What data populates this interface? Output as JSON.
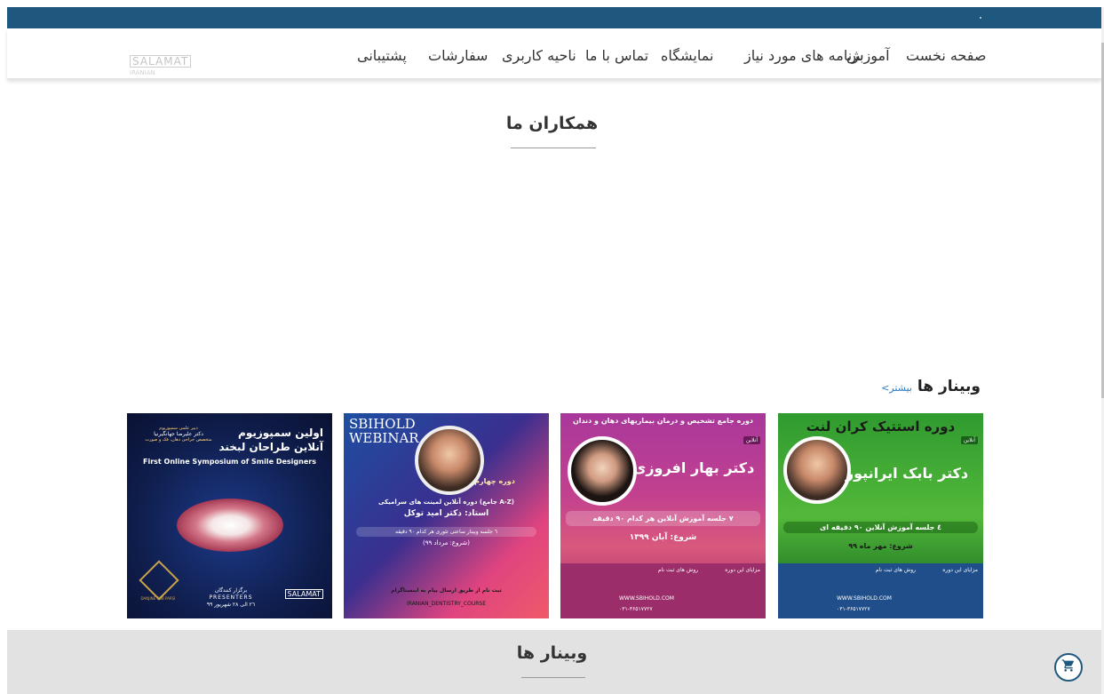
{
  "nav": {
    "items": [
      {
        "label": "صفحه نخست"
      },
      {
        "label": "آموزش"
      },
      {
        "label": "برنامه های مورد نیاز"
      },
      {
        "label": "نمایشگاه"
      },
      {
        "label": "تماس با ما"
      },
      {
        "label": "ناحیه کاربری"
      },
      {
        "label": "سفارشات"
      },
      {
        "label": "پشتیبانی"
      }
    ],
    "logo_text": "SALAMAT",
    "logo_sub": "IRANIAN"
  },
  "partners": {
    "title": "همکاران ما"
  },
  "webinars": {
    "heading": "وبینار ها",
    "more_link": "بیشتر>",
    "cards": [
      {
        "title": "دوره استتیک کران لنت",
        "badge": "آنلاین",
        "doctor": "دکتر بابک ایرانپور",
        "line1": "٤ جلسه آموزش آنلاین ٩٠ دقیقه ای",
        "line2": "شروع: مهر ماه ٩٩",
        "website": "WWW.SBIHOLD.COM",
        "phone": "۰۳۱-۳۶۵۱۷۷۲۷",
        "section1": "مزایای این دوره",
        "section2": "روش های ثبت نام"
      },
      {
        "title": "دوره جامع تشخیص و درمان بیماریهای دهان و دندان",
        "badge": "آنلاین",
        "doctor": "دکتر بهار افروزی",
        "line1": "٧ جلسه آموزش آنلاین هر کدام ٩٠ دقیقه",
        "line2": "شروع: آبان ١٣٩٩",
        "website": "WWW.SBIHOLD.COM",
        "phone": "۰۳۱-۳۶۵۱۷۷۲۷",
        "section1": "مزایای این دوره",
        "section2": "روش های ثبت نام"
      },
      {
        "brand1": "SBIHOLD",
        "brand2": "WEBINAR",
        "ribbon": "دوره چهارم",
        "line1": "دوره آنلاین لمینت های سرامیکی (جامع A-Z)",
        "doctor": "استاد: دکتر امید توکل",
        "line2": "٦ جلسه وبینار ساعتی تئوری هر کدام ٩٠ دقیقه",
        "line3": "(شروع: مرداد ٩٩)",
        "footer": "ثبت نام از طریق ارسال پیام به اینستاگرام",
        "instagram": "IRANIAN_DENTISTRY_COURSE"
      },
      {
        "top_line": "دبیر علمی سمپوزیوم",
        "top_name": "دکتر علیرضا جهانگیرنیا",
        "top_sub": "متخصص جراحی دهان، فک و صورت",
        "title1": "اولین سمپوزیوم",
        "title2": "آنلاین طراحان لبخند",
        "english": "First Online Symposium of Smile Designers",
        "presenters_fa": "برگزار کنندگان",
        "presenters": "PRESENTERS",
        "dates": "٢٦ الی ٢٨ شهریور ٩٩",
        "brand_left": "DANJINE TOB PARSI",
        "logo": "SALAMAT"
      }
    ]
  },
  "webinars_section": {
    "title": "وبینار ها"
  },
  "cart": {
    "icon": "cart-icon"
  },
  "colors": {
    "primary": "#1f587f",
    "band": "#e2e2e2"
  }
}
